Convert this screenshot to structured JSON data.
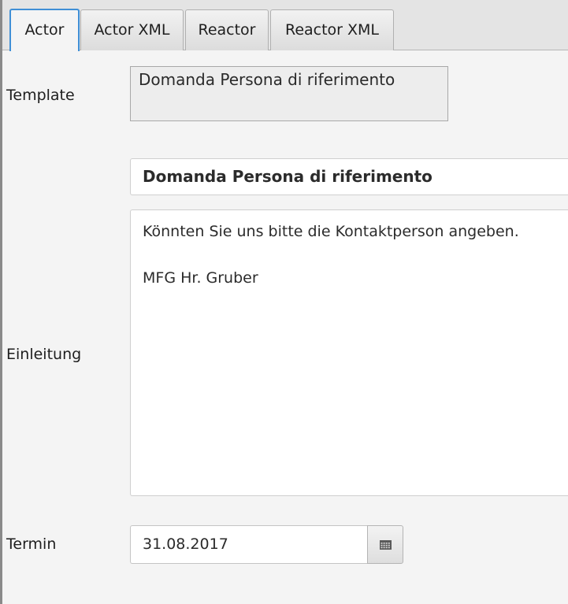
{
  "tabs": [
    {
      "label": "Actor",
      "active": true
    },
    {
      "label": "Actor XML",
      "active": false
    },
    {
      "label": "Reactor",
      "active": false
    },
    {
      "label": "Reactor XML",
      "active": false
    }
  ],
  "form": {
    "template_label": "Template",
    "template_value": "Domanda Persona di riferimento",
    "subject_value": "Domanda Persona di riferimento",
    "einleitung_label": "Einleitung",
    "body_lines": [
      "Könnten Sie uns bitte die Kontaktperson angeben.",
      "MFG Hr. Gruber"
    ],
    "termin_label": "Termin",
    "termin_value": "31.08.2017",
    "calendar_icon": "calendar-icon"
  },
  "colors": {
    "active_tab_border": "#3f8fd6",
    "background": "#f4f4f4",
    "tab_bar": "#e4e4e4"
  }
}
